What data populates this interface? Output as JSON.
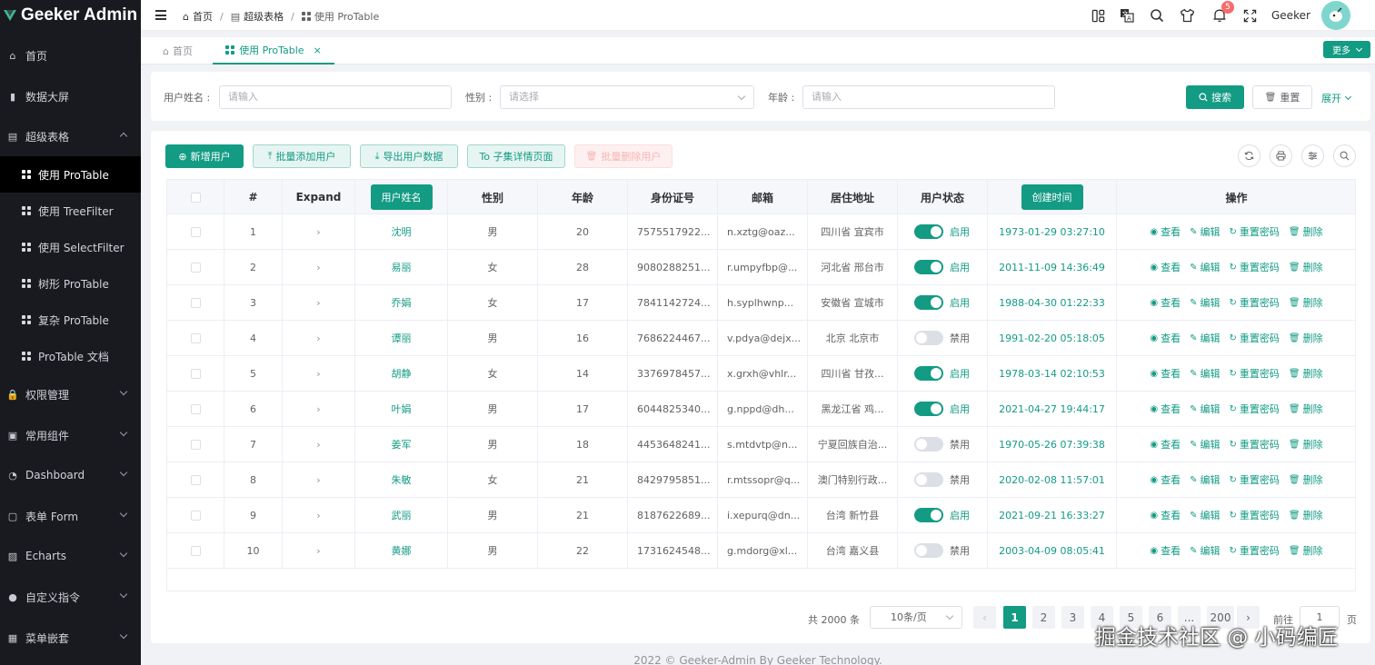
{
  "app": {
    "title": "Geeker Admin"
  },
  "sidebar": {
    "items": [
      {
        "label": "首页",
        "icon": "home-icon"
      },
      {
        "label": "数据大屏",
        "icon": "bar-chart-icon"
      },
      {
        "label": "超级表格",
        "icon": "table-icon",
        "expanded": true
      },
      {
        "label": "使用 ProTable",
        "icon": "grid-icon",
        "sub": true,
        "active": true
      },
      {
        "label": "使用 TreeFilter",
        "icon": "grid-icon",
        "sub": true
      },
      {
        "label": "使用 SelectFilter",
        "icon": "grid-icon",
        "sub": true
      },
      {
        "label": "树形 ProTable",
        "icon": "grid-icon",
        "sub": true
      },
      {
        "label": "复杂 ProTable",
        "icon": "grid-icon",
        "sub": true
      },
      {
        "label": "ProTable 文档",
        "icon": "grid-icon",
        "sub": true
      },
      {
        "label": "权限管理",
        "icon": "lock-icon"
      },
      {
        "label": "常用组件",
        "icon": "briefcase-icon"
      },
      {
        "label": "Dashboard",
        "icon": "dashboard-icon"
      },
      {
        "label": "表单 Form",
        "icon": "form-icon"
      },
      {
        "label": "Echarts",
        "icon": "chart-icon"
      },
      {
        "label": "自定义指令",
        "icon": "user-icon"
      },
      {
        "label": "菜单嵌套",
        "icon": "menu-icon"
      }
    ]
  },
  "header": {
    "breadcrumb": [
      "首页",
      "超级表格",
      "使用 ProTable"
    ],
    "notification_count": "5",
    "username": "Geeker"
  },
  "tabs": {
    "items": [
      {
        "label": "首页"
      },
      {
        "label": "使用 ProTable"
      }
    ],
    "more_label": "更多"
  },
  "search": {
    "fields": [
      {
        "label": "用户姓名 :",
        "placeholder": "请输入"
      },
      {
        "label": "性别 :",
        "placeholder": "请选择"
      },
      {
        "label": "年龄 :",
        "placeholder": "请输入"
      }
    ],
    "search_label": "搜索",
    "reset_label": "重置",
    "expand_label": "展开"
  },
  "toolbar": {
    "add_user": "新增用户",
    "batch_add": "批量添加用户",
    "export": "导出用户数据",
    "to_detail": "To 子集详情页面",
    "batch_delete": "批量删除用户"
  },
  "table": {
    "columns": [
      "#",
      "Expand",
      "用户姓名",
      "性别",
      "年龄",
      "身份证号",
      "邮箱",
      "居住地址",
      "用户状态",
      "创建时间",
      "操作"
    ],
    "actions": [
      "查看",
      "编辑",
      "重置密码",
      "删除"
    ],
    "status_on": "启用",
    "status_off": "禁用",
    "expand_glyph": "›",
    "rows": [
      {
        "index": "1",
        "name": "沈明",
        "gender": "男",
        "age": "20",
        "id": "7575517922...",
        "email": "n.xztg@oaz...",
        "address": "四川省 宜宾市",
        "enabled": true,
        "created": "1973-01-29 03:27:10"
      },
      {
        "index": "2",
        "name": "易丽",
        "gender": "女",
        "age": "28",
        "id": "9080288251...",
        "email": "r.umpyfbp@...",
        "address": "河北省 邢台市",
        "enabled": true,
        "created": "2011-11-09 14:36:49"
      },
      {
        "index": "3",
        "name": "乔娟",
        "gender": "女",
        "age": "17",
        "id": "7841142724...",
        "email": "h.syplhwnp...",
        "address": "安徽省 宣城市",
        "enabled": true,
        "created": "1988-04-30 01:22:33"
      },
      {
        "index": "4",
        "name": "谭丽",
        "gender": "男",
        "age": "16",
        "id": "7686224467...",
        "email": "v.pdya@dejx...",
        "address": "北京 北京市",
        "enabled": false,
        "created": "1991-02-20 05:18:05"
      },
      {
        "index": "5",
        "name": "胡静",
        "gender": "女",
        "age": "14",
        "id": "3376978457...",
        "email": "x.grxh@vhlr...",
        "address": "四川省 甘孜...",
        "enabled": true,
        "created": "1978-03-14 02:10:53"
      },
      {
        "index": "6",
        "name": "叶娟",
        "gender": "男",
        "age": "17",
        "id": "6044825340...",
        "email": "g.nppd@dh...",
        "address": "黑龙江省 鸡...",
        "enabled": true,
        "created": "2021-04-27 19:44:17"
      },
      {
        "index": "7",
        "name": "姜军",
        "gender": "男",
        "age": "18",
        "id": "4453648241...",
        "email": "s.mtdvtp@n...",
        "address": "宁夏回族自治...",
        "enabled": false,
        "created": "1970-05-26 07:39:38"
      },
      {
        "index": "8",
        "name": "朱敏",
        "gender": "女",
        "age": "21",
        "id": "8429795851...",
        "email": "r.mtssopr@q...",
        "address": "澳门特别行政...",
        "enabled": false,
        "created": "2020-02-08 11:57:01"
      },
      {
        "index": "9",
        "name": "武丽",
        "gender": "男",
        "age": "21",
        "id": "8187622689...",
        "email": "i.xepurq@dn...",
        "address": "台湾 新竹县",
        "enabled": true,
        "created": "2021-09-21 16:33:27"
      },
      {
        "index": "10",
        "name": "黄娜",
        "gender": "男",
        "age": "22",
        "id": "1731624548...",
        "email": "g.mdorg@xl...",
        "address": "台湾 嘉义县",
        "enabled": false,
        "created": "2003-04-09 08:05:41"
      }
    ]
  },
  "pagination": {
    "total": "共 2000 条",
    "page_size": "10条/页",
    "pages": [
      "1",
      "2",
      "3",
      "4",
      "5",
      "6",
      "...",
      "200"
    ],
    "current": "1",
    "goto_prefix": "前往",
    "goto_value": "1",
    "goto_suffix": "页"
  },
  "footer": {
    "text": "2022 © Geeker-Admin By Geeker Technology."
  },
  "watermark": "掘金技术社区 @ 小码编匠",
  "colors": {
    "primary": "#139b84",
    "sidebar_bg": "#191a20"
  }
}
